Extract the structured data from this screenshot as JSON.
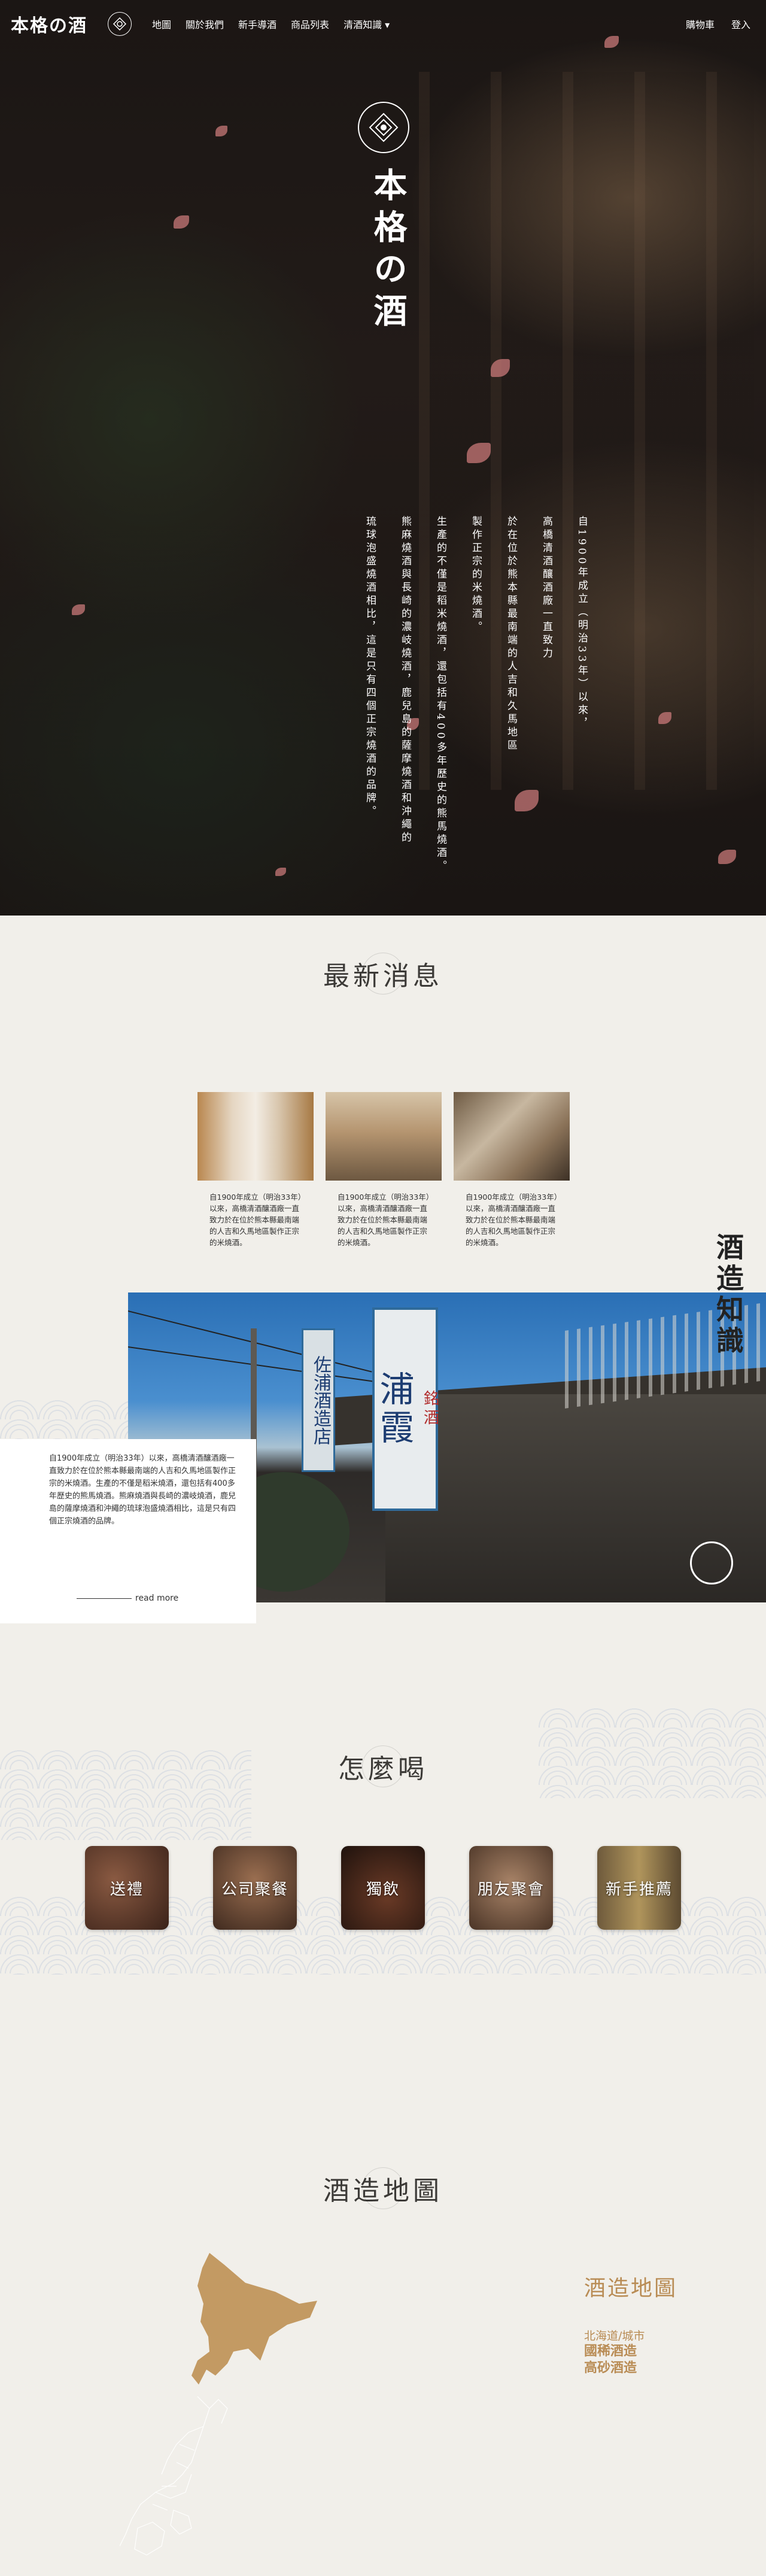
{
  "header": {
    "logo": "本格の酒",
    "nav": [
      "地圖",
      "關於我們",
      "新手導酒",
      "商品列表",
      "清酒知識"
    ],
    "nav_dropdown_arrow": "▾",
    "right": [
      "購物車",
      "登入"
    ]
  },
  "hero": {
    "title": "本格の酒",
    "columns": [
      "自1900年成立（明治33年）以來，",
      "高橋清酒釀酒廠一直致力",
      "於在位於熊本縣最南端的人吉和久馬地區",
      "製作正宗的米燒酒。",
      "生產的不僅是稻米燒酒，還包括有400多年歷史的熊馬燒酒。",
      "熊麻燒酒與長崎的濃岐燒酒，鹿兒島的薩摩燒酒和沖繩的",
      "琉球泡盛燒酒相比，這是只有四個正宗燒酒的品牌。"
    ]
  },
  "news": {
    "title": "最新消息",
    "items": [
      {
        "text": "自1900年成立（明治33年）以來，高橋清酒釀酒廠一直致力於在位於熊本縣最南端的人吉和久馬地區製作正宗的米燒酒。"
      },
      {
        "text": "自1900年成立（明治33年）以來，高橋清酒釀酒廠一直致力於在位於熊本縣最南端的人吉和久馬地區製作正宗的米燒酒。"
      },
      {
        "text": "自1900年成立（明治33年）以來，高橋清酒釀酒廠一直致力於在位於熊本縣最南端的人吉和久馬地區製作正宗的米燒酒。"
      }
    ]
  },
  "knowledge": {
    "title": "酒造知識",
    "sign_main": "浦霞",
    "sign_top": "銘酒",
    "sign_side": "佐浦酒造店",
    "body": "自1900年成立（明治33年）以來，高橋清酒釀酒廠一直致力於在位於熊本縣最南端的人吉和久馬地區製作正宗的米燒酒。生產的不僅是稻米燒酒，還包括有400多年歷史的熊馬燒酒。熊麻燒酒與長崎的濃岐燒酒，鹿兒島的薩摩燒酒和沖繩的琉球泡盛燒酒相比，這是只有四個正宗燒酒的品牌。",
    "read_more": "read more"
  },
  "how": {
    "title": "怎麼喝",
    "items": [
      {
        "label": "送禮",
        "color": "#5a3a2c"
      },
      {
        "label": "公司聚餐",
        "color": "#6b4a36"
      },
      {
        "label": "獨飲",
        "color": "#3a221a"
      },
      {
        "label": "朋友聚會",
        "color": "#7a5a44"
      },
      {
        "label": "新手推薦",
        "color": "#8a6a3e"
      }
    ]
  },
  "map": {
    "title": "酒造地圖",
    "legend_title": "酒造地圖",
    "region": "北海道/城市",
    "breweries": [
      "國稀酒造",
      "高砂酒造"
    ],
    "highlight_color": "#c39a63"
  },
  "colors": {
    "accent": "#b98c55",
    "page_bg": "#f1efea",
    "hero_bg": "#1b1614"
  }
}
